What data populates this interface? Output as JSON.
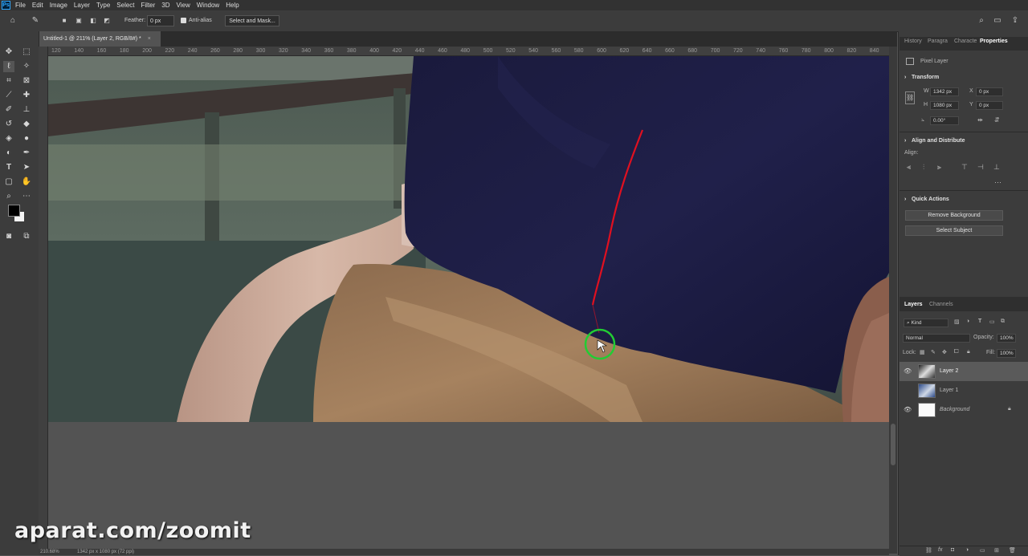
{
  "menubar": {
    "logo": "Ps",
    "items": [
      "File",
      "Edit",
      "Image",
      "Layer",
      "Type",
      "Select",
      "Filter",
      "3D",
      "View",
      "Window",
      "Help"
    ]
  },
  "options": {
    "feather_label": "Feather:",
    "feather_value": "0 px",
    "antialias_label": "Anti-alias",
    "select_mask": "Select and Mask..."
  },
  "document": {
    "tab_title": "Untitled-1 @ 211% (Layer 2, RGB/8#) *",
    "close": "×"
  },
  "ruler": {
    "ticks": [
      "120",
      "140",
      "160",
      "180",
      "200",
      "220",
      "240",
      "260",
      "280",
      "300",
      "320",
      "340",
      "360",
      "380",
      "400",
      "420",
      "440",
      "460",
      "480",
      "500",
      "520",
      "540",
      "560",
      "580",
      "600",
      "620",
      "640",
      "660",
      "680",
      "700",
      "720",
      "740",
      "760",
      "780",
      "800",
      "820",
      "840"
    ]
  },
  "panels": {
    "tabs": [
      "History",
      "Paragra",
      "Characte",
      "Properties"
    ],
    "active_tab": "Properties",
    "pixel_layer": "Pixel Layer",
    "transform": {
      "title": "Transform",
      "w_label": "W",
      "w_value": "1342 px",
      "h_label": "H",
      "h_value": "1080 px",
      "x_label": "X",
      "x_value": "0 px",
      "y_label": "Y",
      "y_value": "0 px",
      "angle_value": "0.00°"
    },
    "align": {
      "title": "Align and Distribute",
      "align_label": "Align:"
    },
    "quick_actions": {
      "title": "Quick Actions",
      "remove_bg": "Remove Background",
      "select_subject": "Select Subject"
    }
  },
  "layers_panel": {
    "tabs": [
      "Layers",
      "Channels"
    ],
    "kind_label": "Kind",
    "blend_mode": "Normal",
    "opacity_label": "Opacity:",
    "opacity_value": "100%",
    "lock_label": "Lock:",
    "fill_label": "Fill:",
    "fill_value": "100%",
    "layers": [
      {
        "name": "Layer 2",
        "visible": true,
        "selected": true
      },
      {
        "name": "Layer 1",
        "visible": false,
        "selected": false
      },
      {
        "name": "Background",
        "visible": true,
        "selected": false,
        "locked": true
      }
    ]
  },
  "status": {
    "zoom": "210.68%",
    "doc_size": "1342 px x 1080 px (72 ppi)"
  },
  "watermark": "aparat.com/zoomit",
  "colors": {
    "selection_brush": "#e01020",
    "cursor_ring": "#22cc33"
  }
}
